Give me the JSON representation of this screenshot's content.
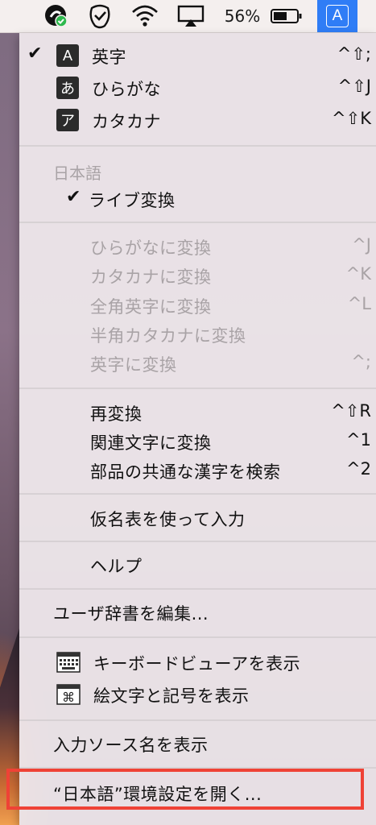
{
  "menubar": {
    "battery_percent": "56%",
    "input_indicator": "A",
    "icons": [
      "app-icon-green-check",
      "clipboard-check-icon",
      "wifi-icon",
      "airplay-icon",
      "battery-icon"
    ]
  },
  "menu": {
    "modes": [
      {
        "icon": "A",
        "label": "英字",
        "shortcut": "^⇧;",
        "checked": true
      },
      {
        "icon": "あ",
        "label": "ひらがな",
        "shortcut": "^⇧J",
        "checked": false
      },
      {
        "icon": "ア",
        "label": "カタカナ",
        "shortcut": "^⇧K",
        "checked": false
      }
    ],
    "section_japanese": "日本語",
    "live_conversion": "ライブ変換",
    "conversions": [
      {
        "label": "ひらがなに変換",
        "shortcut": "^J"
      },
      {
        "label": "カタカナに変換",
        "shortcut": "^K"
      },
      {
        "label": "全角英字に変換",
        "shortcut": "^L"
      },
      {
        "label": "半角カタカナに変換",
        "shortcut": ""
      },
      {
        "label": "英字に変換",
        "shortcut": "^;"
      }
    ],
    "reconvert": {
      "label": "再変換",
      "shortcut": "^⇧R"
    },
    "related": {
      "label": "関連文字に変換",
      "shortcut": "^1"
    },
    "search_kanji": {
      "label": "部品の共通な漢字を検索",
      "shortcut": "^2"
    },
    "kana_input": "仮名表を使って入力",
    "help": "ヘルプ",
    "user_dictionary": "ユーザ辞書を編集...",
    "keyboard_viewer": "キーボードビューアを表示",
    "emoji": "絵文字と記号を表示",
    "show_source": "入力ソース名を表示",
    "open_prefs": "“日本語”環境設定を開く..."
  }
}
